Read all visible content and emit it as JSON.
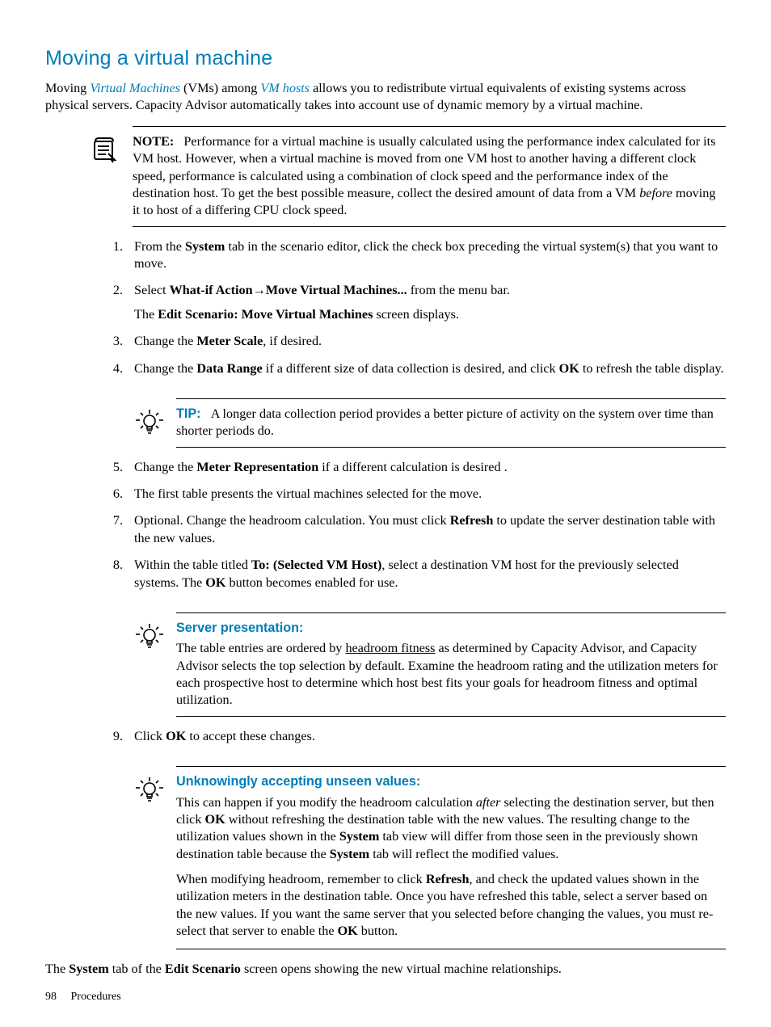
{
  "title": "Moving a virtual machine",
  "intro": {
    "pre": "Moving ",
    "link1": "Virtual Machines",
    "mid": " (VMs) among ",
    "link2": "VM hosts",
    "post": " allows you to redistribute virtual equivalents of existing systems across physical servers. Capacity Advisor automatically takes into account use of dynamic memory by a virtual machine."
  },
  "note": {
    "label": "NOTE:",
    "text_pre": "Performance for a virtual machine is usually calculated using the performance index calculated for its VM host. However, when a virtual machine is moved from one VM host to another having a different clock speed, performance is calculated using a combination of clock speed and the performance index of the destination host. To get the best possible measure, collect the desired amount of data from a VM ",
    "italic": "before",
    "text_post": " moving it to host of a differing CPU clock speed."
  },
  "steps_a": [
    {
      "n": "1.",
      "pre": "From the ",
      "b1": "System",
      "post": " tab in the scenario editor, click the check box preceding the virtual system(s) that you want to move."
    },
    {
      "n": "2.",
      "pre": "Select ",
      "b1": "What-if Action",
      "arrow": "→",
      "b2": "Move Virtual Machines...",
      "post": " from the menu bar.",
      "sub_pre": "The ",
      "sub_b": "Edit Scenario: Move Virtual Machines",
      "sub_post": " screen displays."
    },
    {
      "n": "3.",
      "pre": "Change the ",
      "b1": "Meter Scale",
      "post": ", if desired."
    },
    {
      "n": "4.",
      "pre": "Change the ",
      "b1": "Data Range",
      "mid": " if a different size of data collection is desired, and click ",
      "b2": "OK",
      "post": " to refresh the table display."
    }
  ],
  "tip1": {
    "label": "TIP:",
    "text": "A longer data collection period provides a better picture of activity on the system over time than shorter periods do."
  },
  "steps_b": [
    {
      "n": "5.",
      "pre": "Change the ",
      "b1": "Meter Representation",
      "post": " if a different calculation is desired ."
    },
    {
      "n": "6.",
      "text": "The first table presents the virtual machines selected for the move."
    },
    {
      "n": "7.",
      "pre": "Optional. Change the headroom calculation. You must click ",
      "b1": "Refresh",
      "post": " to update the server destination table with the new values."
    },
    {
      "n": "8.",
      "pre": "Within the table titled ",
      "b1": "To: (Selected VM Host)",
      "mid": ", select a destination VM host for the previously selected systems. The ",
      "b2": "OK",
      "post": " button becomes enabled for use."
    }
  ],
  "server_presentation": {
    "label": "Server presentation:",
    "pre": "The table entries are ordered by ",
    "underlined": "headroom fitness",
    "post": " as determined by Capacity Advisor, and Capacity Advisor selects the top selection by default. Examine the headroom rating and the utilization meters for each prospective host to determine which host best fits your goals for headroom fitness and optimal utilization."
  },
  "steps_c": [
    {
      "n": "9.",
      "pre": "Click ",
      "b1": "OK",
      "post": " to accept these changes."
    }
  ],
  "unseen": {
    "label": "Unknowingly accepting unseen values:",
    "p1": {
      "pre": "This can happen if you modify the headroom calculation ",
      "i": "after",
      "mid": " selecting the destination server, but then click ",
      "b1": "OK",
      "mid2": " without refreshing the destination table with the new values. The resulting change to the utilization values shown in the ",
      "b2": "System",
      "mid3": " tab view will differ from those seen in the previously shown destination table because the ",
      "b3": "System",
      "post": " tab will reflect the modified values."
    },
    "p2": {
      "pre": "When modifying headroom, remember to click ",
      "b1": "Refresh",
      "mid": ", and check the updated values shown in the utilization meters in the destination table. Once you have refreshed this table, select a server based on the new values. If you want the same server that you selected before changing the values, you must re-select that server to enable the ",
      "b2": "OK",
      "post": " button."
    }
  },
  "closing": {
    "pre": "The ",
    "b1": "System",
    "mid": " tab of the ",
    "b2": "Edit Scenario",
    "post": " screen opens showing the new virtual machine relationships."
  },
  "footer": {
    "page": "98",
    "section": "Procedures"
  }
}
